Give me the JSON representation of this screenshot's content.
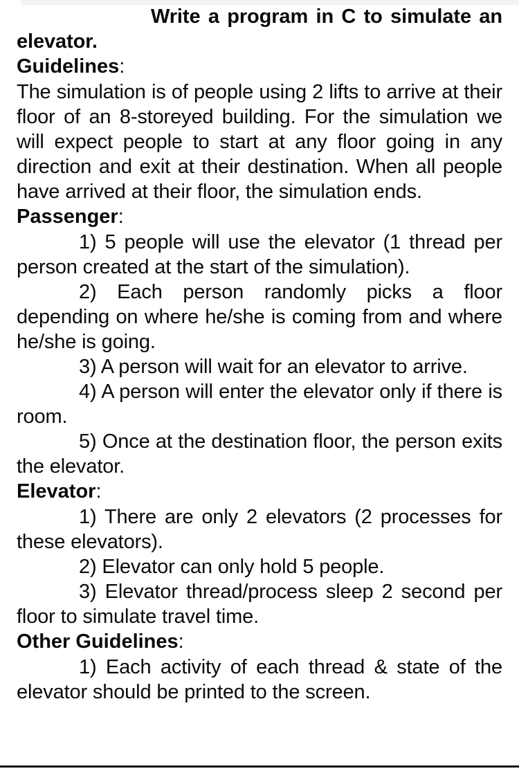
{
  "document": {
    "title": "Write a program in C to simulate an elevator.",
    "sections": [
      {
        "heading": "Guidelines",
        "heading_colon": ":",
        "paragraphs": [
          "The simulation is of people using 2 lifts to arrive at their floor of an 8-storeyed building. For the simulation we will expect people to start at any floor going in any direction and exit at their destination. When all people have arrived at their floor, the simulation ends."
        ]
      },
      {
        "heading": "Passenger",
        "heading_colon": ":",
        "paragraphs": [
          "1) 5 people will use the elevator (1 thread per person created at the start of  the simulation).",
          "2) Each person randomly picks a floor depending on where he/she is coming from and where he/she is going.",
          "3) A person will wait for an elevator to arrive.",
          "4) A person will enter the elevator only if there is room.",
          "5) Once at the destination floor, the person exits the elevator."
        ]
      },
      {
        "heading": "Elevator",
        "heading_colon": ":",
        "paragraphs": [
          "1) There are only 2 elevators (2 processes for these elevators).",
          "2) Elevator can only hold 5 people.",
          "3) Elevator thread/process sleep 2 second per floor to simulate travel time."
        ]
      },
      {
        "heading": "Other Guidelines",
        "heading_colon": ":",
        "paragraphs": [
          "1) Each activity of each thread & state of the elevator should be printed to the screen."
        ]
      }
    ],
    "colors": {
      "text": "#0a0a0a",
      "page_background": "#ffffff",
      "top_strip": "#f3f3f3",
      "bottom_rule": "#111111"
    }
  }
}
